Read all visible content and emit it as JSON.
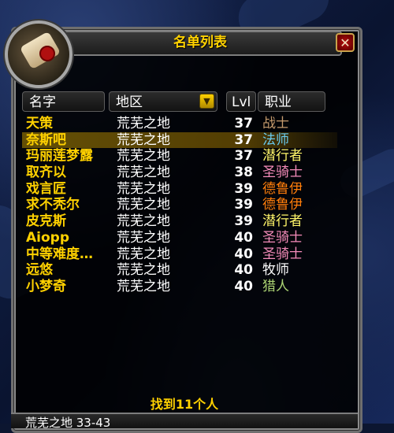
{
  "window": {
    "title": "名单列表",
    "close_glyph": "✕"
  },
  "columns": {
    "name": "名字",
    "zone": "地区",
    "level": "Lvl",
    "class": "职业"
  },
  "rows": [
    {
      "name": "天策",
      "zone": "荒芜之地",
      "level": "37",
      "class": "战士",
      "class_color": "#c69b6d"
    },
    {
      "name": "奈斯吧",
      "zone": "荒芜之地",
      "level": "37",
      "class": "法师",
      "class_color": "#69ccf0"
    },
    {
      "name": "玛丽莲梦露",
      "zone": "荒芜之地",
      "level": "37",
      "class": "潜行者",
      "class_color": "#fff569"
    },
    {
      "name": "取齐以",
      "zone": "荒芜之地",
      "level": "38",
      "class": "圣骑士",
      "class_color": "#f58cba"
    },
    {
      "name": "戏言匠",
      "zone": "荒芜之地",
      "level": "39",
      "class": "德鲁伊",
      "class_color": "#ff7d0a"
    },
    {
      "name": "求不秃尔",
      "zone": "荒芜之地",
      "level": "39",
      "class": "德鲁伊",
      "class_color": "#ff7d0a"
    },
    {
      "name": "皮克斯",
      "zone": "荒芜之地",
      "level": "39",
      "class": "潜行者",
      "class_color": "#fff569"
    },
    {
      "name": "Aiopp",
      "zone": "荒芜之地",
      "level": "40",
      "class": "圣骑士",
      "class_color": "#f58cba"
    },
    {
      "name": "中等难度…",
      "zone": "荒芜之地",
      "level": "40",
      "class": "圣骑士",
      "class_color": "#f58cba"
    },
    {
      "name": "远悠",
      "zone": "荒芜之地",
      "level": "40",
      "class": "牧师",
      "class_color": "#ffffff"
    },
    {
      "name": "小梦奇",
      "zone": "荒芜之地",
      "level": "40",
      "class": "猎人",
      "class_color": "#abd473"
    }
  ],
  "selected_row": 1,
  "footer": {
    "found_text": "找到11个人"
  },
  "bottom_bar": {
    "text": "荒芜之地 33-43"
  },
  "colors": {
    "accent": "#ffd100",
    "frame": "#7d7d7d",
    "close_red": "#b81010"
  },
  "icons": {
    "portrait": "scroll-icon",
    "dropdown": "dropdown-arrow-icon",
    "close": "close-icon"
  }
}
